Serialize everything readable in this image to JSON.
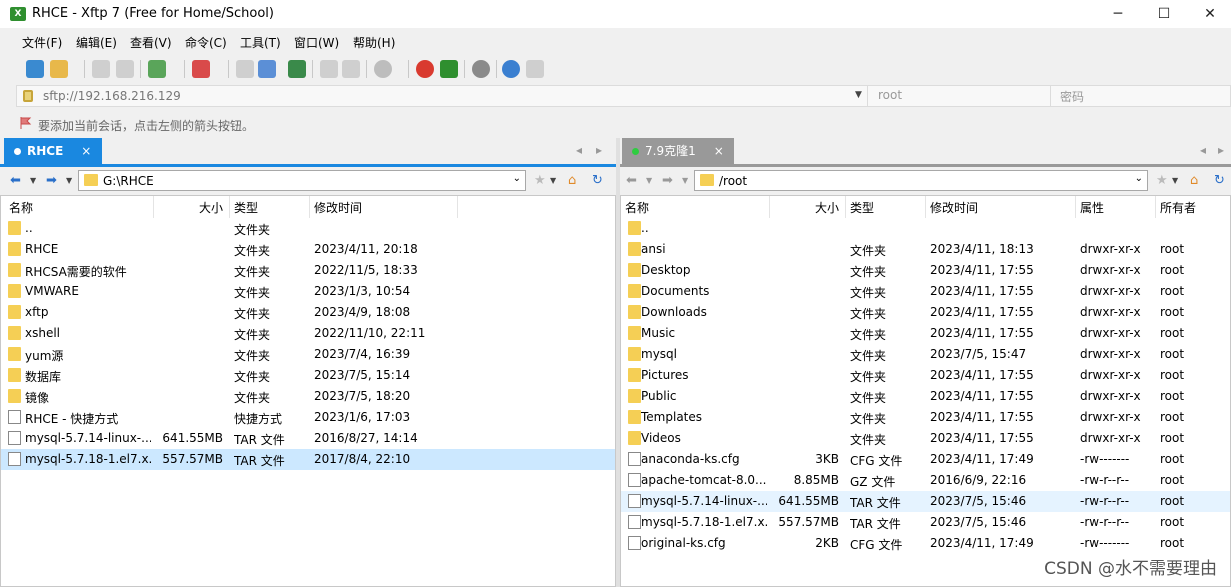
{
  "window": {
    "title": "RHCE - Xftp 7 (Free for Home/School)",
    "app_icon": "xftp-icon",
    "minimize": "─",
    "maximize": "☐",
    "close": "✕"
  },
  "menu": [
    "文件(F)",
    "编辑(E)",
    "查看(V)",
    "命令(C)",
    "工具(T)",
    "窗口(W)",
    "帮助(H)"
  ],
  "address": {
    "url": "sftp://192.168.216.129",
    "user_placeholder": "root",
    "password_placeholder": "密码"
  },
  "info": {
    "text": "要添加当前会话，点击左侧的箭头按钮。"
  },
  "left": {
    "tab": {
      "label": "RHCE",
      "close": "×"
    },
    "path": "G:\\RHCE",
    "columns": [
      "名称",
      "大小",
      "类型",
      "修改时间"
    ],
    "rows": [
      {
        "name": "..",
        "size": "",
        "type": "文件夹",
        "date": "",
        "icon": "folder"
      },
      {
        "name": "RHCE",
        "size": "",
        "type": "文件夹",
        "date": "2023/4/11, 20:18",
        "icon": "folder"
      },
      {
        "name": "RHCSA需要的软件",
        "size": "",
        "type": "文件夹",
        "date": "2022/11/5, 18:33",
        "icon": "folder"
      },
      {
        "name": "VMWARE",
        "size": "",
        "type": "文件夹",
        "date": "2023/1/3, 10:54",
        "icon": "folder"
      },
      {
        "name": "xftp",
        "size": "",
        "type": "文件夹",
        "date": "2023/4/9, 18:08",
        "icon": "folder"
      },
      {
        "name": "xshell",
        "size": "",
        "type": "文件夹",
        "date": "2022/11/10, 22:11",
        "icon": "folder"
      },
      {
        "name": "yum源",
        "size": "",
        "type": "文件夹",
        "date": "2023/7/4, 16:39",
        "icon": "folder"
      },
      {
        "name": "数据库",
        "size": "",
        "type": "文件夹",
        "date": "2023/7/5, 15:14",
        "icon": "folder"
      },
      {
        "name": "镜像",
        "size": "",
        "type": "文件夹",
        "date": "2023/7/5, 18:20",
        "icon": "folder"
      },
      {
        "name": "RHCE - 快捷方式",
        "size": "",
        "type": "快捷方式",
        "date": "2023/1/6, 17:03",
        "icon": "shortcut"
      },
      {
        "name": "mysql-5.7.14-linux-...",
        "size": "641.55MB",
        "type": "TAR 文件",
        "date": "2016/8/27, 14:14",
        "icon": "file"
      },
      {
        "name": "mysql-5.7.18-1.el7.x...",
        "size": "557.57MB",
        "type": "TAR 文件",
        "date": "2017/8/4, 22:10",
        "icon": "file",
        "selected": true
      }
    ]
  },
  "right": {
    "tab": {
      "label": "7.9克隆1",
      "close": "×",
      "status_color": "#2ecc40"
    },
    "path": "/root",
    "columns": [
      "名称",
      "大小",
      "类型",
      "修改时间",
      "属性",
      "所有者"
    ],
    "rows": [
      {
        "name": "..",
        "size": "",
        "type": "",
        "date": "",
        "attr": "",
        "owner": "",
        "icon": "folder"
      },
      {
        "name": "ansi",
        "size": "",
        "type": "文件夹",
        "date": "2023/4/11, 18:13",
        "attr": "drwxr-xr-x",
        "owner": "root",
        "icon": "folder"
      },
      {
        "name": "Desktop",
        "size": "",
        "type": "文件夹",
        "date": "2023/4/11, 17:55",
        "attr": "drwxr-xr-x",
        "owner": "root",
        "icon": "folder"
      },
      {
        "name": "Documents",
        "size": "",
        "type": "文件夹",
        "date": "2023/4/11, 17:55",
        "attr": "drwxr-xr-x",
        "owner": "root",
        "icon": "folder"
      },
      {
        "name": "Downloads",
        "size": "",
        "type": "文件夹",
        "date": "2023/4/11, 17:55",
        "attr": "drwxr-xr-x",
        "owner": "root",
        "icon": "folder"
      },
      {
        "name": "Music",
        "size": "",
        "type": "文件夹",
        "date": "2023/4/11, 17:55",
        "attr": "drwxr-xr-x",
        "owner": "root",
        "icon": "folder"
      },
      {
        "name": "mysql",
        "size": "",
        "type": "文件夹",
        "date": "2023/7/5, 15:47",
        "attr": "drwxr-xr-x",
        "owner": "root",
        "icon": "folder"
      },
      {
        "name": "Pictures",
        "size": "",
        "type": "文件夹",
        "date": "2023/4/11, 17:55",
        "attr": "drwxr-xr-x",
        "owner": "root",
        "icon": "folder"
      },
      {
        "name": "Public",
        "size": "",
        "type": "文件夹",
        "date": "2023/4/11, 17:55",
        "attr": "drwxr-xr-x",
        "owner": "root",
        "icon": "folder"
      },
      {
        "name": "Templates",
        "size": "",
        "type": "文件夹",
        "date": "2023/4/11, 17:55",
        "attr": "drwxr-xr-x",
        "owner": "root",
        "icon": "folder"
      },
      {
        "name": "Videos",
        "size": "",
        "type": "文件夹",
        "date": "2023/4/11, 17:55",
        "attr": "drwxr-xr-x",
        "owner": "root",
        "icon": "folder"
      },
      {
        "name": "anaconda-ks.cfg",
        "size": "3KB",
        "type": "CFG 文件",
        "date": "2023/4/11, 17:49",
        "attr": "-rw-------",
        "owner": "root",
        "icon": "file"
      },
      {
        "name": "apache-tomcat-8.0....",
        "size": "8.85MB",
        "type": "GZ 文件",
        "date": "2016/6/9, 22:16",
        "attr": "-rw-r--r--",
        "owner": "root",
        "icon": "file"
      },
      {
        "name": "mysql-5.7.14-linux-...",
        "size": "641.55MB",
        "type": "TAR 文件",
        "date": "2023/7/5, 15:46",
        "attr": "-rw-r--r--",
        "owner": "root",
        "icon": "file",
        "hover": true
      },
      {
        "name": "mysql-5.7.18-1.el7.x...",
        "size": "557.57MB",
        "type": "TAR 文件",
        "date": "2023/7/5, 15:46",
        "attr": "-rw-r--r--",
        "owner": "root",
        "icon": "file"
      },
      {
        "name": "original-ks.cfg",
        "size": "2KB",
        "type": "CFG 文件",
        "date": "2023/4/11, 17:49",
        "attr": "-rw-------",
        "owner": "root",
        "icon": "file"
      }
    ]
  },
  "watermark": "CSDN @水不需要理由",
  "colors": {
    "accent": "#1a88e0",
    "selected_row": "#cce8ff",
    "folder": "#f5cf55"
  }
}
